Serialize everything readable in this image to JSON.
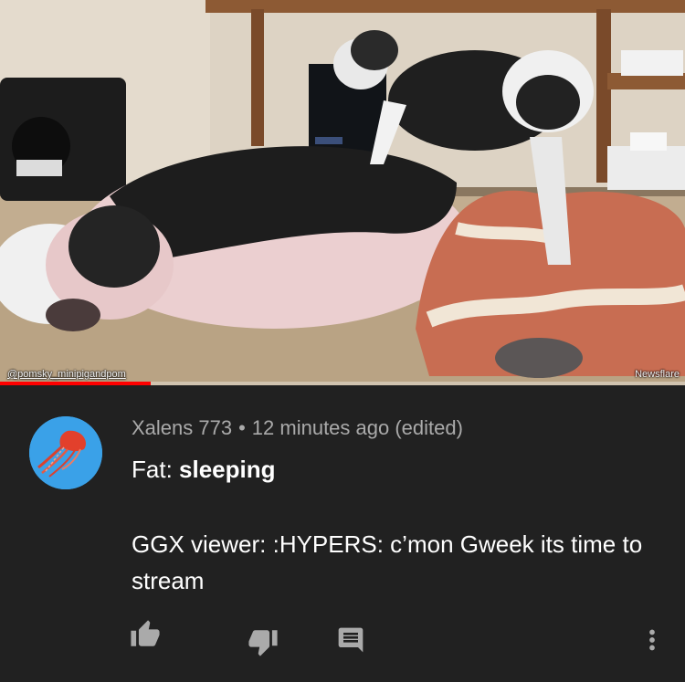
{
  "video": {
    "watermark_left": "@pomsky_minipigandpom",
    "watermark_right": "Newsflare",
    "progress": 0.22
  },
  "comment": {
    "author": "Xalens 773",
    "separator": "•",
    "timestamp": "12 minutes ago (edited)",
    "line1_prefix": "Fat: ",
    "line1_bold": "sleeping",
    "body": "GGX viewer: :HYPERS: c’mon Gweek its time to stream",
    "avatar_icon": "jellyfish-icon"
  },
  "actions": [
    {
      "name": "like-button",
      "icon": "thumbs-up-icon"
    },
    {
      "name": "dislike-button",
      "icon": "thumbs-down-icon"
    },
    {
      "name": "reply-button",
      "icon": "comment-icon"
    },
    {
      "name": "more-options-button",
      "icon": "more-vert-icon"
    }
  ],
  "colors": {
    "background": "#212121",
    "meta_text": "#aaaaaa",
    "progress": "#ff0000",
    "icon": "#aaaaaa"
  }
}
